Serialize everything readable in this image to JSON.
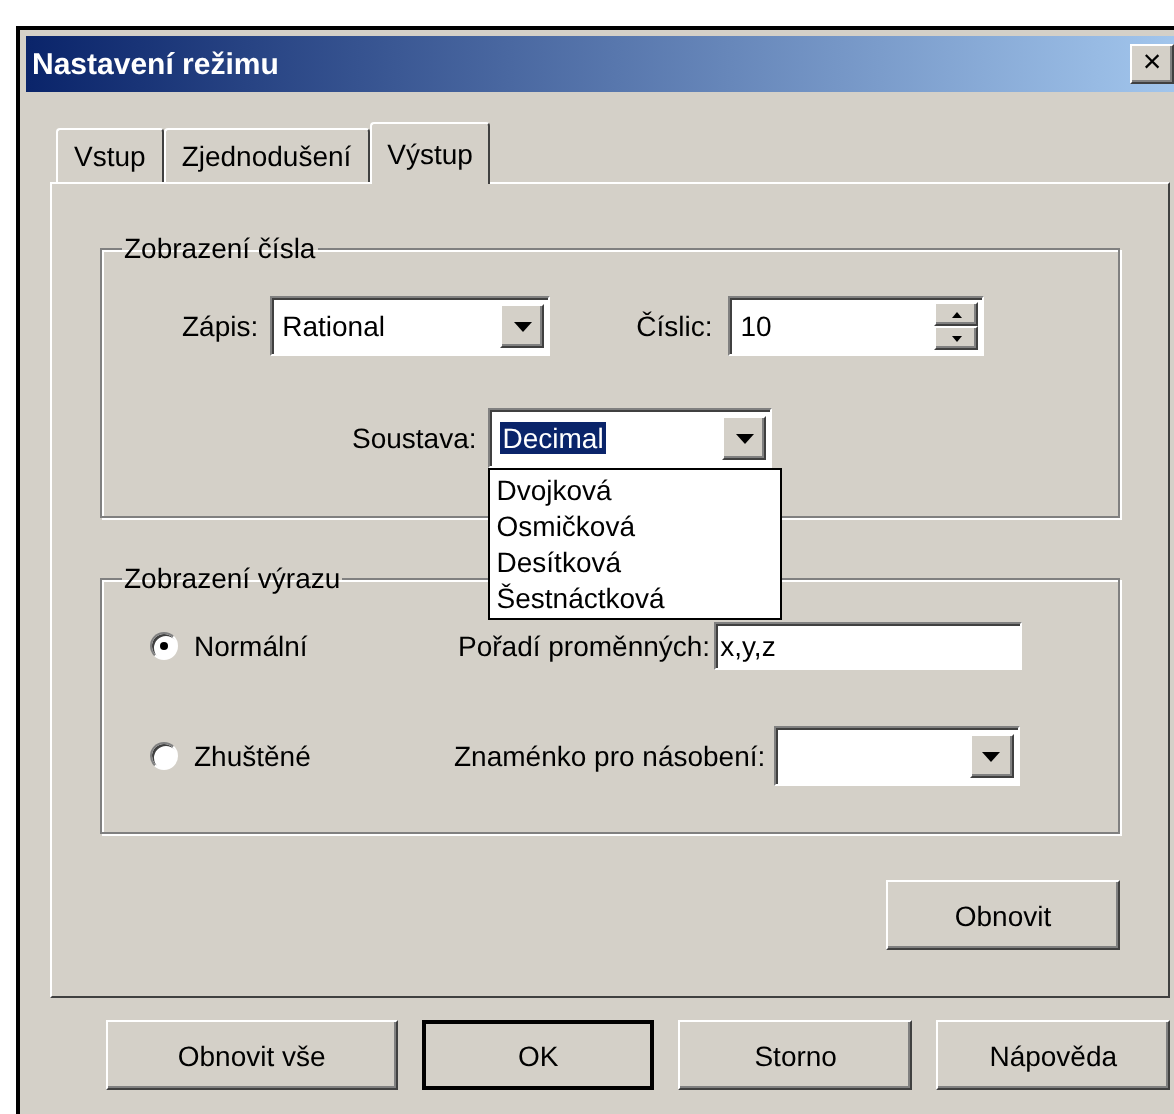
{
  "window": {
    "title": "Nastavení režimu",
    "close": "×"
  },
  "tabs": [
    {
      "label": "Vstup",
      "selected": false
    },
    {
      "label": "Zjednodušení",
      "selected": false
    },
    {
      "label": "Výstup",
      "selected": true
    }
  ],
  "number_display": {
    "title": "Zobrazení čísla",
    "notation": {
      "label": "Zápis:",
      "value": "Rational"
    },
    "digits": {
      "label": "Číslic:",
      "value": "10"
    },
    "base": {
      "label": "Soustava:",
      "value": "Decimal",
      "expanded": true,
      "options": [
        "Dvojková",
        "Osmičková",
        "Desítková",
        "Šestnáctková"
      ]
    }
  },
  "expression_display": {
    "title": "Zobrazení výrazu",
    "modes": [
      {
        "label": "Normální",
        "selected": true
      },
      {
        "label": "Zhuštěné",
        "selected": false
      }
    ],
    "variable_order": {
      "label": "Pořadí proměnných:",
      "value": "x,y,z"
    },
    "multiplication_sign": {
      "label": "Znaménko pro násobení:"
    }
  },
  "reset_button": "Obnovit",
  "buttons": [
    {
      "label": "Obnovit vše",
      "default": false
    },
    {
      "label": "OK",
      "default": true
    },
    {
      "label": "Storno",
      "default": false
    },
    {
      "label": "Nápověda",
      "default": false
    }
  ]
}
